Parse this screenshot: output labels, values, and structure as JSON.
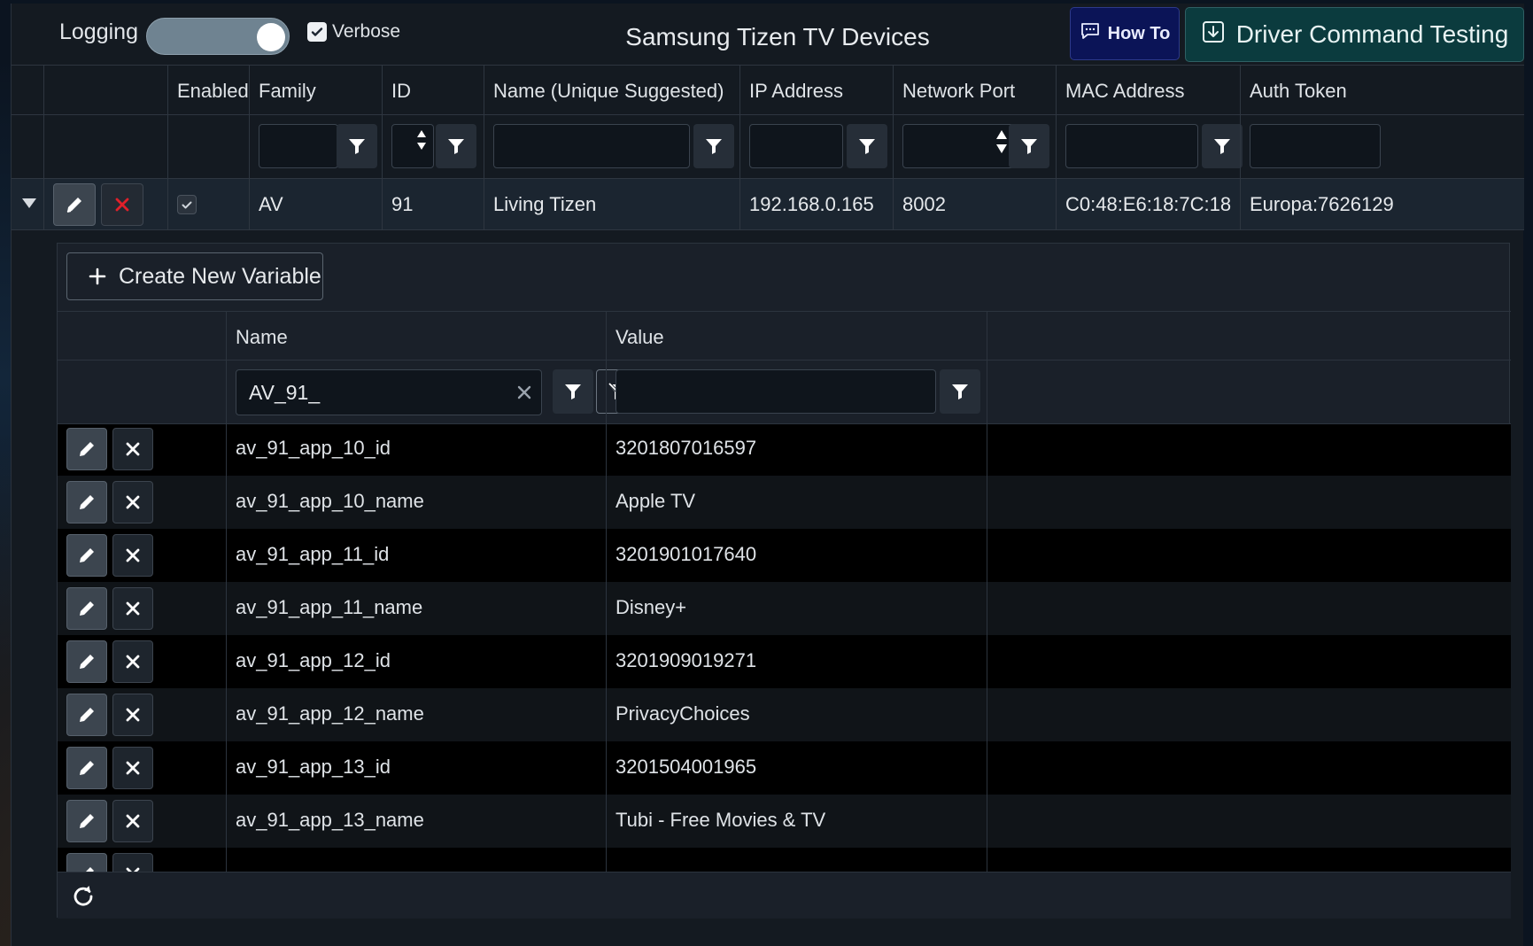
{
  "toolbar": {
    "logging_label": "Logging",
    "logging_on": true,
    "verbose_label": "Verbose",
    "verbose_checked": true,
    "title": "Samsung Tizen TV Devices",
    "howto_label": "How To",
    "driver_label": "Driver Command Testing"
  },
  "device_grid": {
    "columns": [
      "Enabled",
      "Family",
      "ID",
      "Name (Unique Suggested)",
      "IP Address",
      "Network Port",
      "MAC Address",
      "Auth Token"
    ],
    "row": {
      "enabled": true,
      "family": "AV",
      "id": "91",
      "name": "Living Tizen",
      "ip": "192.168.0.165",
      "port": "8002",
      "mac": "C0:48:E6:18:7C:18",
      "auth_token": "Europa:7626129"
    }
  },
  "variables": {
    "create_label": "Create New Variable",
    "columns": [
      "Name",
      "Value"
    ],
    "name_filter_value": "AV_91_",
    "rows": [
      {
        "name": "av_91_app_10_id",
        "value": "3201807016597"
      },
      {
        "name": "av_91_app_10_name",
        "value": "Apple TV"
      },
      {
        "name": "av_91_app_11_id",
        "value": "3201901017640"
      },
      {
        "name": "av_91_app_11_name",
        "value": "Disney+"
      },
      {
        "name": "av_91_app_12_id",
        "value": "3201909019271"
      },
      {
        "name": "av_91_app_12_name",
        "value": "PrivacyChoices"
      },
      {
        "name": "av_91_app_13_id",
        "value": "3201504001965"
      },
      {
        "name": "av_91_app_13_name",
        "value": "Tubi - Free Movies & TV"
      }
    ]
  },
  "colors": {
    "accent_howto": "#0b1457",
    "accent_driver": "#0b3b3e",
    "delete_red": "#e0202a"
  }
}
